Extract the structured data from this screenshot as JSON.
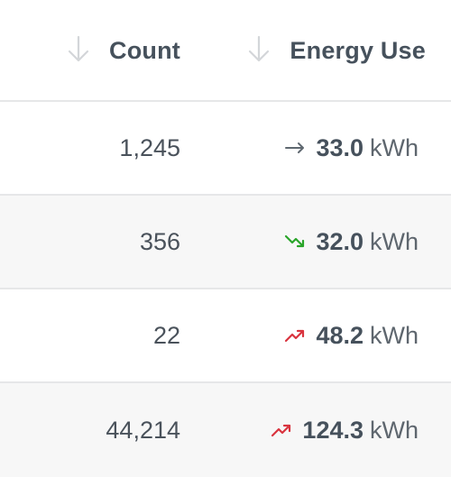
{
  "header": {
    "count_label": "Count",
    "energy_label": "Energy Use",
    "sort_icon": "arrow-down-icon"
  },
  "rows": [
    {
      "count": "1,245",
      "trend": "flat",
      "energy": "33.0",
      "unit": "kWh"
    },
    {
      "count": "356",
      "trend": "down",
      "energy": "32.0",
      "unit": "kWh"
    },
    {
      "count": "22",
      "trend": "up",
      "energy": "48.2",
      "unit": "kWh"
    },
    {
      "count": "44,214",
      "trend": "up",
      "energy": "124.3",
      "unit": "kWh"
    }
  ],
  "colors": {
    "trend_flat": "#5f6870",
    "trend_down": "#2aa52a",
    "trend_up": "#d9343f",
    "row_alt": "#f7f7f7",
    "divider": "#e6e7e8"
  }
}
